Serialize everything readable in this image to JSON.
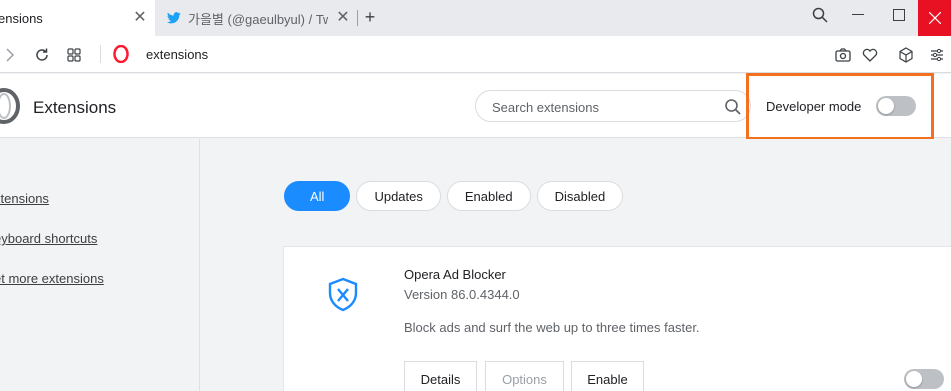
{
  "tabs": {
    "active": {
      "title": "ensions",
      "close": "✕"
    },
    "inactive": {
      "title": "가을별 (@gaeulbyul) / Twit",
      "close": "✕",
      "favicon": "twitter-bird-icon"
    },
    "new_tab": "+"
  },
  "window": {
    "minimize": "—",
    "maximize": "☐",
    "close": "✕"
  },
  "addressbar": {
    "url": "extensions"
  },
  "header": {
    "title": "Extensions",
    "search_placeholder": "Search extensions",
    "developer_mode_label": "Developer mode",
    "developer_mode_on": false
  },
  "sidebar": {
    "items": [
      {
        "label": "xtensions"
      },
      {
        "label": "eyboard shortcuts"
      },
      {
        "label": "et more extensions"
      }
    ]
  },
  "filters": [
    {
      "label": "All",
      "active": true
    },
    {
      "label": "Updates",
      "active": false
    },
    {
      "label": "Enabled",
      "active": false
    },
    {
      "label": "Disabled",
      "active": false
    }
  ],
  "extension": {
    "name": "Opera Ad Blocker",
    "version": "Version 86.0.4344.0",
    "description": "Block ads and surf the web up to three times faster.",
    "buttons": {
      "details": "Details",
      "options": "Options",
      "enable": "Enable"
    },
    "enabled": false
  },
  "colors": {
    "accent": "#1a8cff",
    "highlight": "#f37021",
    "close_red": "#e81123",
    "shield_blue": "#1a8cff"
  }
}
